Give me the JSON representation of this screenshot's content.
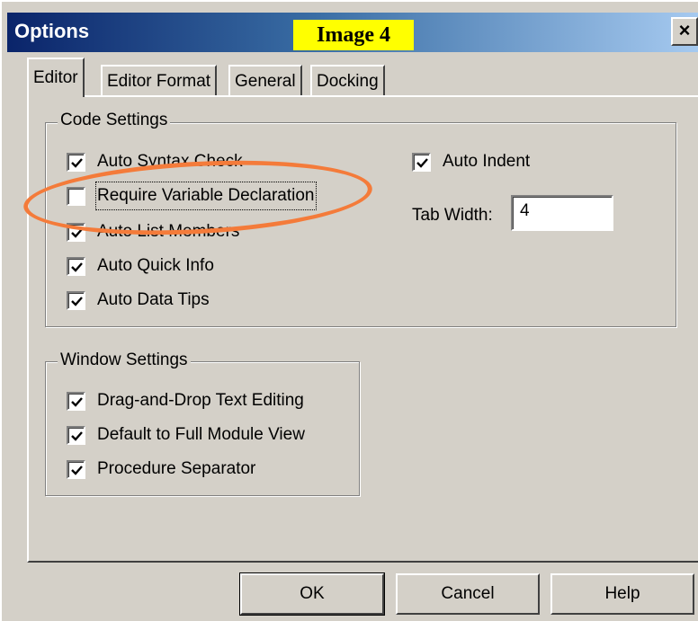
{
  "window": {
    "title": "Options",
    "image_label": "Image 4",
    "close_label": "×"
  },
  "tabs": [
    {
      "label": "Editor",
      "active": true
    },
    {
      "label": "Editor Format",
      "active": false
    },
    {
      "label": "General",
      "active": false
    },
    {
      "label": "Docking",
      "active": false
    }
  ],
  "code_settings": {
    "legend": "Code Settings",
    "checkboxes": [
      {
        "label": "Auto Syntax Check",
        "checked": true
      },
      {
        "label": "Require Variable Declaration",
        "checked": false
      },
      {
        "label": "Auto List Members",
        "checked": true
      },
      {
        "label": "Auto Quick Info",
        "checked": true
      },
      {
        "label": "Auto Data Tips",
        "checked": true
      }
    ],
    "auto_indent": {
      "label": "Auto Indent",
      "checked": true
    },
    "tab_width": {
      "label": "Tab Width:",
      "value": "4"
    }
  },
  "window_settings": {
    "legend": "Window Settings",
    "checkboxes": [
      {
        "label": "Drag-and-Drop Text Editing",
        "checked": true
      },
      {
        "label": "Default to Full Module View",
        "checked": true
      },
      {
        "label": "Procedure Separator",
        "checked": true
      }
    ]
  },
  "buttons": {
    "ok": "OK",
    "cancel": "Cancel",
    "help": "Help"
  },
  "colors": {
    "annotation": "#f47b3a",
    "dialog_face": "#d4d0c8",
    "title_start": "#0a246a",
    "image_label_bg": "#ffff00"
  }
}
